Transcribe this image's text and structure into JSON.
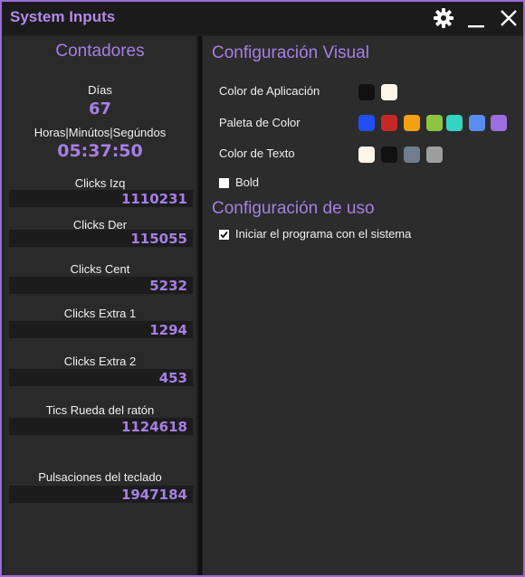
{
  "window": {
    "title": "System Inputs"
  },
  "icons": {
    "settings": "gear-icon",
    "minimize": "minimize-icon",
    "close": "close-icon"
  },
  "counters": {
    "heading": "Contadores",
    "days_label": "Días",
    "days_value": "67",
    "time_label": "Horas|Minútos|Segúndos",
    "time_value": "05:37:50",
    "items": [
      {
        "label": "Clicks Izq",
        "value": "1110231"
      },
      {
        "label": "Clicks Der",
        "value": "115055"
      },
      {
        "label": "Clicks Cent",
        "value": "5232"
      },
      {
        "label": "Clicks Extra 1",
        "value": "1294"
      },
      {
        "label": "Clicks Extra 2",
        "value": "453"
      },
      {
        "label": "Tics Rueda del ratón",
        "value": "1124618"
      },
      {
        "label": "Pulsaciones del teclado",
        "value": "1947184"
      }
    ]
  },
  "visual_config": {
    "heading": "Configuración Visual",
    "app_color_label": "Color de Aplicación",
    "app_colors": [
      "#111111",
      "#fdf6e8"
    ],
    "palette_label": "Paleta de Color",
    "palette_colors": [
      "#1f4ff5",
      "#c62828",
      "#f5a011",
      "#8cc63f",
      "#34d3c2",
      "#5b8def",
      "#9b6fe0"
    ],
    "text_color_label": "Color de Texto",
    "text_colors": [
      "#fdf6e8",
      "#111111",
      "#6e7e8e",
      "#9e9e9e"
    ],
    "bold_label": "Bold",
    "bold_checked": false
  },
  "usage_config": {
    "heading": "Configuración de uso",
    "startup_label": "Iniciar el programa con el sistema",
    "startup_checked": true
  },
  "colors": {
    "accent": "#a67fe4",
    "border": "#9a6cd6"
  }
}
